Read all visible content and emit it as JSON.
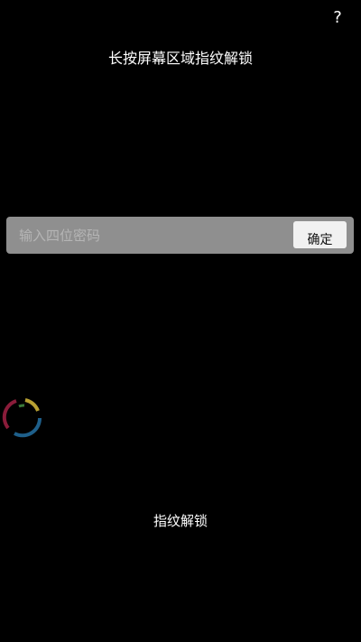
{
  "header": {
    "help_label": "?",
    "hint_text": "长按屏幕区域指纹解锁"
  },
  "password": {
    "value": "",
    "placeholder": "输入四位密码",
    "confirm_label": "确定"
  },
  "fingerprint": {
    "label": "指纹解锁"
  },
  "spinner": {
    "colors": [
      "#b8a032",
      "#1e5f8a",
      "#8a1c3a",
      "#3a7a3a"
    ]
  }
}
